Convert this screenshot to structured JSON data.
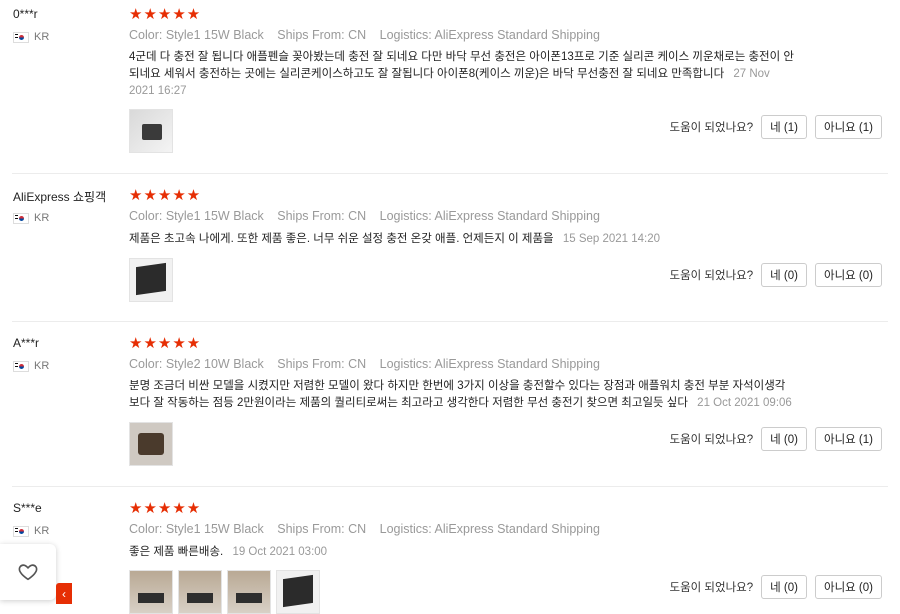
{
  "reviews": [
    {
      "user": "0***r",
      "country": "KR",
      "stars": "★★★★★",
      "color": "Color: Style1 15W Black",
      "ships": "Ships From: CN",
      "logistics": "Logistics: AliExpress Standard Shipping",
      "text": "4군데 다 충전 잘 됩니다 애플펜슬 꽂아봤는데 충전 잘 되네요 다만 바닥 무선 충전은 아이폰13프로 기준 실리콘 케이스 끼운채로는 충전이 안되네요 세워서 충전하는 곳에는 실리콘케이스하고도 잘 잘됩니다 아이폰8(케이스 끼운)은 바닥 무선충전 잘 되네요 만족합니다",
      "date": "27 Nov 2021 16:27",
      "helpful_label": "도움이 되었나요?",
      "yes": "네 (1)",
      "no": "아니요 (1)"
    },
    {
      "user": "AliExpress 쇼핑객",
      "country": "KR",
      "stars": "★★★★★",
      "color": "Color: Style1 15W Black",
      "ships": "Ships From: CN",
      "logistics": "Logistics: AliExpress Standard Shipping",
      "text": "제품은 초고속 나에게. 또한 제품 좋은. 너무 쉬운 설정 충전 온갖 애플. 언제든지 이 제품을",
      "date": "15 Sep 2021 14:20",
      "helpful_label": "도움이 되었나요?",
      "yes": "네 (0)",
      "no": "아니요 (0)"
    },
    {
      "user": "A***r",
      "country": "KR",
      "stars": "★★★★★",
      "color": "Color: Style2 10W Black",
      "ships": "Ships From: CN",
      "logistics": "Logistics: AliExpress Standard Shipping",
      "text": "분명 조금더 비싼 모델을 시켰지만 저렴한 모델이 왔다 하지만 한번에 3가지 이상을 충전할수 있다는 장점과 애플워치 충전 부분 자석이생각보다 잘 작동하는 점등 2만원이라는 제품의 퀄리티로써는 최고라고 생각한다 저렴한 무선 충전기 찾으면 최고일듯 싶다",
      "date": "21 Oct 2021 09:06",
      "helpful_label": "도움이 되었나요?",
      "yes": "네 (0)",
      "no": "아니요 (1)"
    },
    {
      "user": "S***e",
      "country": "KR",
      "stars": "★★★★★",
      "color": "Color: Style1 15W Black",
      "ships": "Ships From: CN",
      "logistics": "Logistics: AliExpress Standard Shipping",
      "text": "좋은 제품 빠른배송.",
      "date": "19 Oct 2021 03:00",
      "helpful_label": "도움이 되었나요?",
      "yes": "네 (0)",
      "no": "아니요 (0)"
    }
  ],
  "icons": {
    "wishlist": "heart-icon",
    "flag": "korea-flag-icon"
  },
  "colors": {
    "star": "#e62e04",
    "meta": "#999999"
  }
}
